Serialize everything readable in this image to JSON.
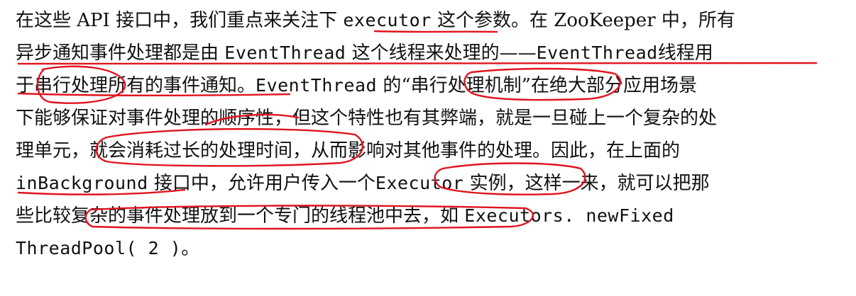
{
  "paragraph": {
    "line1": {
      "a": "在这些 API 接口中，我们重点来关注下 ",
      "b": "executor",
      "c": " 这个参数。在 ZooKeeper 中，所有"
    },
    "line2": {
      "a": "异步通知事件处理都是由 ",
      "b": "EventThread",
      "c": " 这个线程来处理的——",
      "d": "EventThread",
      "e": "线程用"
    },
    "line3": {
      "a": "于串行处理所有的事件通知。",
      "b": "EventThread",
      "c": " 的“串行处理机制”在绝大部分应用场景"
    },
    "line4": "下能够保证对事件处理的顺序性，但这个特性也有其弊端，就是一旦碰上一个复杂的处",
    "line5": "理单元，就会消耗过长的处理时间，从而影响对其他事件的处理。因此，在上面的",
    "line6": {
      "a": "inBackground",
      "b": " 接口中，允许用户传入一个",
      "c": "Executor",
      "d": " 实例，这样一来，就可以把那"
    },
    "line7": {
      "a": "些比较复杂的事件处理放到一个专门的线程池中去，如 ",
      "b": "Executors. newFixed"
    },
    "line8": {
      "a": "ThreadPool( 2 )",
      "b": "。"
    }
  },
  "annotation_color": "#e0141e"
}
